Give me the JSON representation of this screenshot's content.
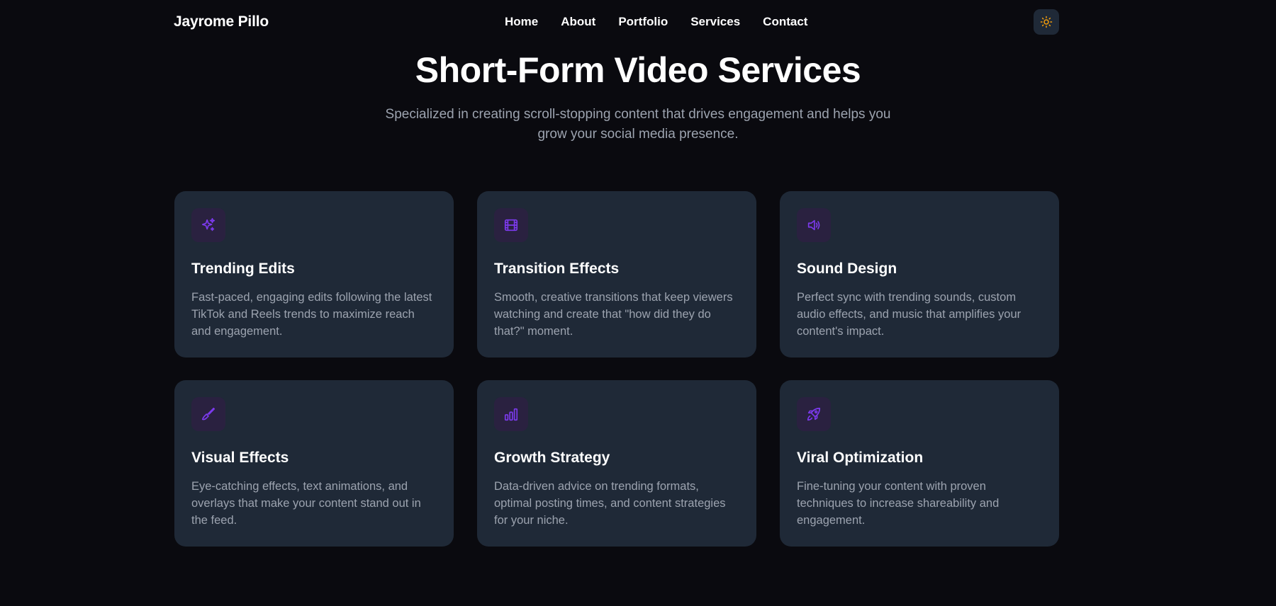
{
  "nav": {
    "brand": "Jayrome Pillo",
    "links": [
      {
        "label": "Home"
      },
      {
        "label": "About"
      },
      {
        "label": "Portfolio"
      },
      {
        "label": "Services"
      },
      {
        "label": "Contact"
      }
    ],
    "theme_toggle_icon": "sun-icon"
  },
  "hero": {
    "title": "Short-Form Video Services",
    "subtitle": "Specialized in creating scroll-stopping content that drives engagement and helps you grow your social media presence."
  },
  "colors": {
    "background": "#0a0a0f",
    "card": "#1f2937",
    "icon_accent": "#7c3aed",
    "sun": "#f59e0b",
    "muted_text": "#9ca3af"
  },
  "services": [
    {
      "icon": "sparkles-icon",
      "title": "Trending Edits",
      "description": "Fast-paced, engaging edits following the latest TikTok and Reels trends to maximize reach and engagement."
    },
    {
      "icon": "film-icon",
      "title": "Transition Effects",
      "description": "Smooth, creative transitions that keep viewers watching and create that \"how did they do that?\" moment."
    },
    {
      "icon": "speaker-icon",
      "title": "Sound Design",
      "description": "Perfect sync with trending sounds, custom audio effects, and music that amplifies your content's impact."
    },
    {
      "icon": "brush-icon",
      "title": "Visual Effects",
      "description": "Eye-catching effects, text animations, and overlays that make your content stand out in the feed."
    },
    {
      "icon": "bar-chart-icon",
      "title": "Growth Strategy",
      "description": "Data-driven advice on trending formats, optimal posting times, and content strategies for your niche."
    },
    {
      "icon": "rocket-icon",
      "title": "Viral Optimization",
      "description": "Fine-tuning your content with proven techniques to increase shareability and engagement."
    }
  ]
}
